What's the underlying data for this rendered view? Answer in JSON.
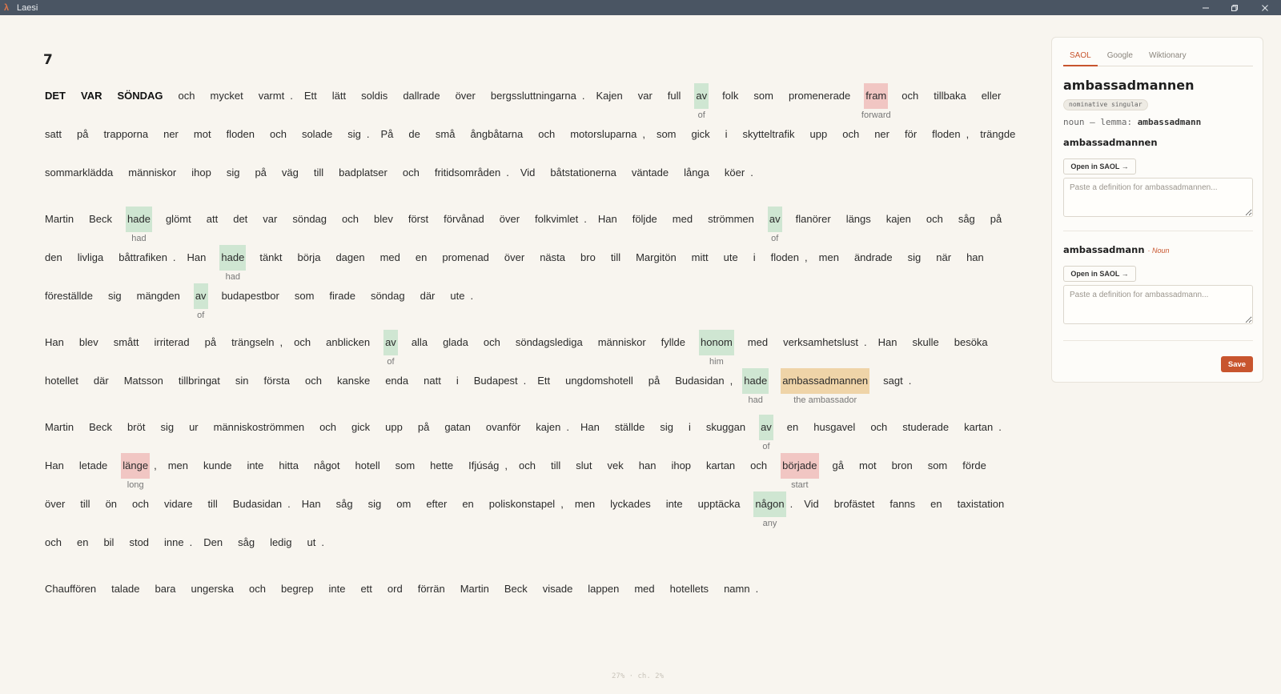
{
  "window": {
    "app_icon": "λ",
    "title": "Laesi"
  },
  "reader": {
    "chapter_number": "7",
    "paragraphs": [
      [
        [
          {
            "t": "DET",
            "bold": true
          },
          {
            "t": "VAR",
            "bold": true
          },
          {
            "t": "SÖNDAG",
            "bold": true
          },
          {
            "t": "och"
          },
          {
            "t": "mycket"
          },
          {
            "t": "varmt"
          },
          {
            "t": ".",
            "p": true
          },
          {
            "t": "Ett"
          },
          {
            "t": "lätt"
          },
          {
            "t": "soldis"
          },
          {
            "t": "dallrade"
          },
          {
            "t": "över"
          },
          {
            "t": "bergssluttningarna"
          },
          {
            "t": ".",
            "p": true
          },
          {
            "t": "Kajen"
          },
          {
            "t": "var"
          },
          {
            "t": "full"
          },
          {
            "t": "av",
            "hl": "green",
            "g": "of"
          },
          {
            "t": "folk"
          },
          {
            "t": "som"
          },
          {
            "t": "promenerade"
          },
          {
            "t": "fram",
            "hl": "red",
            "g": "forward"
          },
          {
            "t": "och"
          },
          {
            "t": "tillbaka"
          },
          {
            "t": "eller"
          }
        ],
        [
          {
            "t": "satt"
          },
          {
            "t": "på"
          },
          {
            "t": "trapporna"
          },
          {
            "t": "ner"
          },
          {
            "t": "mot"
          },
          {
            "t": "floden"
          },
          {
            "t": "och"
          },
          {
            "t": "solade"
          },
          {
            "t": "sig"
          },
          {
            "t": ".",
            "p": true
          },
          {
            "t": "På"
          },
          {
            "t": "de"
          },
          {
            "t": "små"
          },
          {
            "t": "ångbåtarna"
          },
          {
            "t": "och"
          },
          {
            "t": "motorsluparna"
          },
          {
            "t": ",",
            "p": true
          },
          {
            "t": "som"
          },
          {
            "t": "gick"
          },
          {
            "t": "i"
          },
          {
            "t": "skytteltrafik"
          },
          {
            "t": "upp"
          },
          {
            "t": "och"
          },
          {
            "t": "ner"
          },
          {
            "t": "för"
          },
          {
            "t": "floden"
          },
          {
            "t": ",",
            "p": true
          },
          {
            "t": "trängde"
          }
        ],
        [
          {
            "t": "sommarklädda"
          },
          {
            "t": "människor"
          },
          {
            "t": "ihop"
          },
          {
            "t": "sig"
          },
          {
            "t": "på"
          },
          {
            "t": "väg"
          },
          {
            "t": "till"
          },
          {
            "t": "badplatser"
          },
          {
            "t": "och"
          },
          {
            "t": "fritidsområden"
          },
          {
            "t": ".",
            "p": true
          },
          {
            "t": "Vid"
          },
          {
            "t": "båtstationerna"
          },
          {
            "t": "väntade"
          },
          {
            "t": "långa"
          },
          {
            "t": "köer"
          },
          {
            "t": ".",
            "p": true
          }
        ]
      ],
      [
        [
          {
            "t": "Martin"
          },
          {
            "t": "Beck"
          },
          {
            "t": "hade",
            "hl": "green",
            "g": "had"
          },
          {
            "t": "glömt"
          },
          {
            "t": "att"
          },
          {
            "t": "det"
          },
          {
            "t": "var"
          },
          {
            "t": "söndag"
          },
          {
            "t": "och"
          },
          {
            "t": "blev"
          },
          {
            "t": "först"
          },
          {
            "t": "förvånad"
          },
          {
            "t": "över"
          },
          {
            "t": "folkvimlet"
          },
          {
            "t": ".",
            "p": true
          },
          {
            "t": "Han"
          },
          {
            "t": "följde"
          },
          {
            "t": "med"
          },
          {
            "t": "strömmen"
          },
          {
            "t": "av",
            "hl": "green",
            "g": "of"
          },
          {
            "t": "flanörer"
          },
          {
            "t": "längs"
          },
          {
            "t": "kajen"
          },
          {
            "t": "och"
          },
          {
            "t": "såg"
          },
          {
            "t": "på"
          }
        ],
        [
          {
            "t": "den"
          },
          {
            "t": "livliga"
          },
          {
            "t": "båttrafiken"
          },
          {
            "t": ".",
            "p": true
          },
          {
            "t": "Han"
          },
          {
            "t": "hade",
            "hl": "green",
            "g": "had"
          },
          {
            "t": "tänkt"
          },
          {
            "t": "börja"
          },
          {
            "t": "dagen"
          },
          {
            "t": "med"
          },
          {
            "t": "en"
          },
          {
            "t": "promenad"
          },
          {
            "t": "över"
          },
          {
            "t": "nästa"
          },
          {
            "t": "bro"
          },
          {
            "t": "till"
          },
          {
            "t": "Margitön"
          },
          {
            "t": "mitt"
          },
          {
            "t": "ute"
          },
          {
            "t": "i"
          },
          {
            "t": "floden"
          },
          {
            "t": ",",
            "p": true
          },
          {
            "t": "men"
          },
          {
            "t": "ändrade"
          },
          {
            "t": "sig"
          },
          {
            "t": "när"
          },
          {
            "t": "han"
          }
        ],
        [
          {
            "t": "föreställde"
          },
          {
            "t": "sig"
          },
          {
            "t": "mängden"
          },
          {
            "t": "av",
            "hl": "green",
            "g": "of"
          },
          {
            "t": "budapestbor"
          },
          {
            "t": "som"
          },
          {
            "t": "firade"
          },
          {
            "t": "söndag"
          },
          {
            "t": "där"
          },
          {
            "t": "ute"
          },
          {
            "t": ".",
            "p": true
          }
        ]
      ],
      [
        [
          {
            "t": "Han"
          },
          {
            "t": "blev"
          },
          {
            "t": "smått"
          },
          {
            "t": "irriterad"
          },
          {
            "t": "på"
          },
          {
            "t": "trängseln"
          },
          {
            "t": ",",
            "p": true
          },
          {
            "t": "och"
          },
          {
            "t": "anblicken"
          },
          {
            "t": "av",
            "hl": "green",
            "g": "of"
          },
          {
            "t": "alla"
          },
          {
            "t": "glada"
          },
          {
            "t": "och"
          },
          {
            "t": "söndagslediga"
          },
          {
            "t": "människor"
          },
          {
            "t": "fyllde"
          },
          {
            "t": "honom",
            "hl": "green",
            "g": "him"
          },
          {
            "t": "med"
          },
          {
            "t": "verksamhetslust"
          },
          {
            "t": ".",
            "p": true
          },
          {
            "t": "Han"
          },
          {
            "t": "skulle"
          },
          {
            "t": "besöka"
          }
        ],
        [
          {
            "t": "hotellet"
          },
          {
            "t": "där"
          },
          {
            "t": "Matsson"
          },
          {
            "t": "tillbringat"
          },
          {
            "t": "sin"
          },
          {
            "t": "första"
          },
          {
            "t": "och"
          },
          {
            "t": "kanske"
          },
          {
            "t": "enda"
          },
          {
            "t": "natt"
          },
          {
            "t": "i"
          },
          {
            "t": "Budapest"
          },
          {
            "t": ".",
            "p": true
          },
          {
            "t": "Ett"
          },
          {
            "t": "ungdomshotell"
          },
          {
            "t": "på"
          },
          {
            "t": "Budasidan"
          },
          {
            "t": ",",
            "p": true
          },
          {
            "t": "hade",
            "hl": "green",
            "g": "had"
          },
          {
            "t": "ambassadmannen",
            "hl": "amber",
            "g": "the ambassador"
          },
          {
            "t": "sagt"
          },
          {
            "t": ".",
            "p": true
          }
        ]
      ],
      [
        [
          {
            "t": "Martin"
          },
          {
            "t": "Beck"
          },
          {
            "t": "bröt"
          },
          {
            "t": "sig"
          },
          {
            "t": "ur"
          },
          {
            "t": "människoströmmen"
          },
          {
            "t": "och"
          },
          {
            "t": "gick"
          },
          {
            "t": "upp"
          },
          {
            "t": "på"
          },
          {
            "t": "gatan"
          },
          {
            "t": "ovanför"
          },
          {
            "t": "kajen"
          },
          {
            "t": ".",
            "p": true
          },
          {
            "t": "Han"
          },
          {
            "t": "ställde"
          },
          {
            "t": "sig"
          },
          {
            "t": "i"
          },
          {
            "t": "skuggan"
          },
          {
            "t": "av",
            "hl": "green",
            "g": "of"
          },
          {
            "t": "en"
          },
          {
            "t": "husgavel"
          },
          {
            "t": "och"
          },
          {
            "t": "studerade"
          },
          {
            "t": "kartan"
          },
          {
            "t": ".",
            "p": true
          }
        ],
        [
          {
            "t": "Han"
          },
          {
            "t": "letade"
          },
          {
            "t": "länge",
            "hl": "red",
            "g": "long"
          },
          {
            "t": ",",
            "p": true
          },
          {
            "t": "men"
          },
          {
            "t": "kunde"
          },
          {
            "t": "inte"
          },
          {
            "t": "hitta"
          },
          {
            "t": "något"
          },
          {
            "t": "hotell"
          },
          {
            "t": "som"
          },
          {
            "t": "hette"
          },
          {
            "t": "Ifjúság"
          },
          {
            "t": ",",
            "p": true
          },
          {
            "t": "och"
          },
          {
            "t": "till"
          },
          {
            "t": "slut"
          },
          {
            "t": "vek"
          },
          {
            "t": "han"
          },
          {
            "t": "ihop"
          },
          {
            "t": "kartan"
          },
          {
            "t": "och"
          },
          {
            "t": "började",
            "hl": "red",
            "g": "start"
          },
          {
            "t": "gå"
          },
          {
            "t": "mot"
          },
          {
            "t": "bron"
          },
          {
            "t": "som"
          },
          {
            "t": "förde"
          }
        ],
        [
          {
            "t": "över"
          },
          {
            "t": "till"
          },
          {
            "t": "ön"
          },
          {
            "t": "och"
          },
          {
            "t": "vidare"
          },
          {
            "t": "till"
          },
          {
            "t": "Budasidan"
          },
          {
            "t": ".",
            "p": true
          },
          {
            "t": "Han"
          },
          {
            "t": "såg"
          },
          {
            "t": "sig"
          },
          {
            "t": "om"
          },
          {
            "t": "efter"
          },
          {
            "t": "en"
          },
          {
            "t": "poliskonstapel"
          },
          {
            "t": ",",
            "p": true
          },
          {
            "t": "men"
          },
          {
            "t": "lyckades"
          },
          {
            "t": "inte"
          },
          {
            "t": "upptäcka"
          },
          {
            "t": "någon",
            "hl": "green",
            "g": "any"
          },
          {
            "t": ".",
            "p": true
          },
          {
            "t": "Vid"
          },
          {
            "t": "brofästet"
          },
          {
            "t": "fanns"
          },
          {
            "t": "en"
          },
          {
            "t": "taxistation"
          }
        ],
        [
          {
            "t": "och"
          },
          {
            "t": "en"
          },
          {
            "t": "bil"
          },
          {
            "t": "stod"
          },
          {
            "t": "inne"
          },
          {
            "t": ".",
            "p": true
          },
          {
            "t": "Den"
          },
          {
            "t": "såg"
          },
          {
            "t": "ledig"
          },
          {
            "t": "ut"
          },
          {
            "t": ".",
            "p": true
          }
        ]
      ],
      [
        [
          {
            "t": "Chauffören"
          },
          {
            "t": "talade"
          },
          {
            "t": "bara"
          },
          {
            "t": "ungerska"
          },
          {
            "t": "och"
          },
          {
            "t": "begrep"
          },
          {
            "t": "inte"
          },
          {
            "t": "ett"
          },
          {
            "t": "ord"
          },
          {
            "t": "förrän"
          },
          {
            "t": "Martin"
          },
          {
            "t": "Beck"
          },
          {
            "t": "visade"
          },
          {
            "t": "lappen"
          },
          {
            "t": "med"
          },
          {
            "t": "hotellets"
          },
          {
            "t": "namn"
          },
          {
            "t": ".",
            "p": true
          }
        ]
      ]
    ],
    "progress_text": "27% · ch. 2%"
  },
  "panel": {
    "tabs": [
      {
        "label": "SAOL",
        "active": true
      },
      {
        "label": "Google",
        "active": false
      },
      {
        "label": "Wiktionary",
        "active": false
      }
    ],
    "entry_word": "ambassadmannen",
    "form_badge": "nominative singular",
    "lemma_prefix": "noun — lemma:",
    "lemma_value": "ambassadmann",
    "section1": {
      "word": "ambassadmannen",
      "button_label": "Open in SAOL →",
      "placeholder": "Paste a definition for ambassadmannen...",
      "value": ""
    },
    "section2": {
      "word": "ambassadmann",
      "word_class": "· Noun",
      "button_label": "Open in SAOL →",
      "placeholder": "Paste a definition for ambassadmann...",
      "value": ""
    },
    "save_label": "Save"
  }
}
